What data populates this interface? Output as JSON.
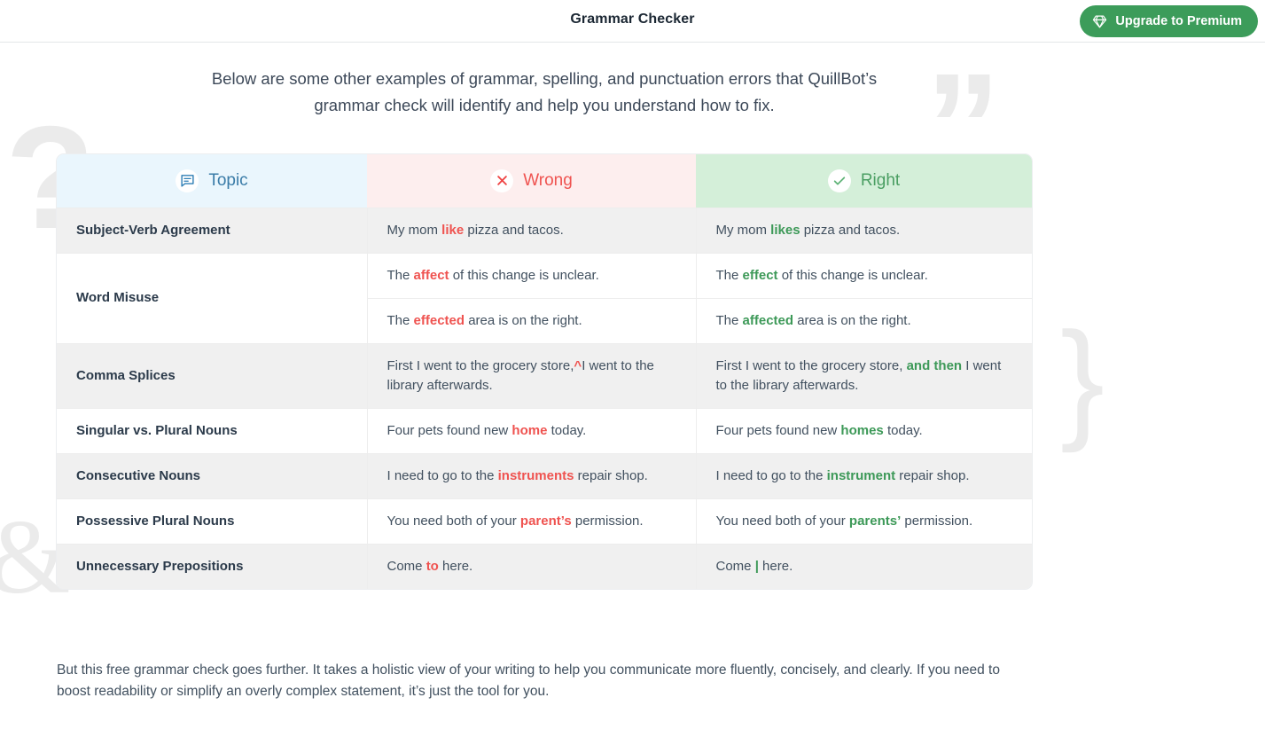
{
  "topbar": {
    "title": "Grammar Checker",
    "upgrade_label": "Upgrade to Premium",
    "upgrade_icon": "diamond-icon",
    "upgrade_color": "#3c9c5a"
  },
  "decorations": [
    {
      "name": "question-mark-decoration",
      "glyph": "?"
    },
    {
      "name": "quotation-mark-decoration",
      "glyph": "”"
    },
    {
      "name": "curly-brace-decoration",
      "glyph": "}"
    },
    {
      "name": "ampersand-decoration",
      "glyph": "&"
    }
  ],
  "intro": {
    "text": "Below are some other examples of grammar, spelling, and punctuation errors that QuillBot’s grammar check will identify and help you understand how to fix."
  },
  "table": {
    "headers": [
      {
        "label": "Topic",
        "icon": "comment-icon",
        "color": "#3a7ca8",
        "bg": "#eaf6fd"
      },
      {
        "label": "Wrong",
        "icon": "x-circle-icon",
        "color": "#ef5350",
        "bg": "#fdeeee"
      },
      {
        "label": "Right",
        "icon": "check-circle-icon",
        "color": "#4a9e62",
        "bg": "#d4efd9"
      }
    ],
    "rows": [
      {
        "topic": "Subject-Verb Agreement",
        "wrong_pre": "My mom ",
        "wrong_hl": "like",
        "wrong_post": " pizza and tacos.",
        "right_pre": "My mom ",
        "right_hl": "likes",
        "right_post": " pizza and tacos."
      },
      {
        "topic": "Word Misuse",
        "wrong_pre": "The ",
        "wrong_hl": "affect",
        "wrong_post": " of this change is unclear.",
        "right_pre": "The ",
        "right_hl": "effect",
        "right_post": " of this change is unclear."
      },
      {
        "topic": "",
        "wrong_pre": "The ",
        "wrong_hl": "effected",
        "wrong_post": " area is on the right.",
        "right_pre": "The ",
        "right_hl": "affected",
        "right_post": " area is on the right."
      },
      {
        "topic": "Comma Splices",
        "wrong_pre": "First I went to the grocery store,",
        "wrong_hl": "^",
        "wrong_post": "I went to the library afterwards.",
        "right_pre": "First I went to the grocery store, ",
        "right_hl": "and then",
        "right_post": " I went to the library afterwards."
      },
      {
        "topic": "Singular vs. Plural Nouns",
        "wrong_pre": "Four pets found new ",
        "wrong_hl": "home",
        "wrong_post": " today.",
        "right_pre": "Four pets found new ",
        "right_hl": "homes",
        "right_post": " today."
      },
      {
        "topic": "Consecutive Nouns",
        "wrong_pre": "I need to go to the ",
        "wrong_hl": "instruments",
        "wrong_post": " repair shop.",
        "right_pre": "I need to go to the ",
        "right_hl": "instrument",
        "right_post": " repair shop."
      },
      {
        "topic": "Possessive Plural Nouns",
        "wrong_pre": "You need both of your ",
        "wrong_hl": "parent’s",
        "wrong_post": " permission.",
        "right_pre": "You need both of your ",
        "right_hl": "parents’",
        "right_post": " permission."
      },
      {
        "topic": "Unnecessary Prepositions",
        "wrong_pre": "Come ",
        "wrong_hl": "to",
        "wrong_post": " here.",
        "right_pre": "Come ",
        "right_hl": "|",
        "right_post": " here."
      }
    ]
  },
  "footer": {
    "text": "But this free grammar check goes further. It takes a holistic view of your writing to help you communicate more fluently, concisely, and clearly. If you need to boost readability or simplify an overly complex statement, it’s just the tool for you."
  }
}
